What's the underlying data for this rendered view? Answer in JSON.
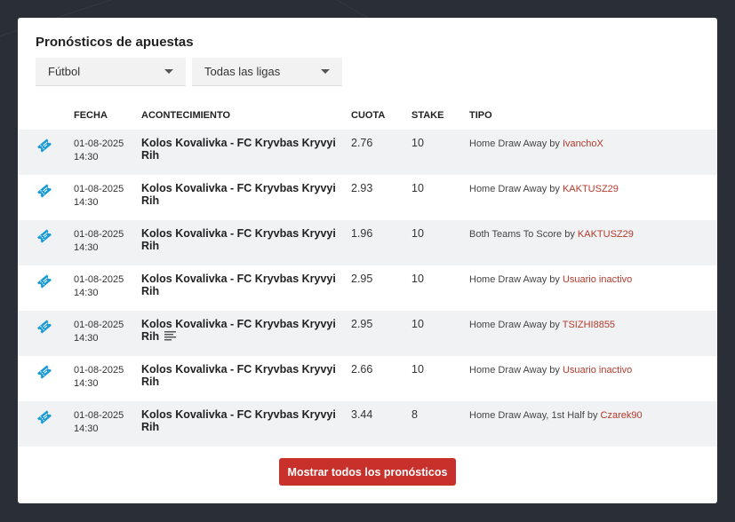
{
  "page": {
    "title": "Pronósticos de apuestas",
    "sport_filter": "Fútbol",
    "league_filter": "Todas las ligas",
    "show_all_label": "Mostrar todos los pronósticos"
  },
  "columns": {
    "fecha": "FECHA",
    "acontecimiento": "ACONTECIMIENTO",
    "cuota": "CUOTA",
    "stake": "STAKE",
    "tipo": "TIPO"
  },
  "rows": [
    {
      "date": "01-08-2025",
      "time": "14:30",
      "event": "Kolos Kovalivka - FC Kryvbas Kryvyi Rih",
      "odds": "2.76",
      "stake": "10",
      "tip": "Home Draw Away by",
      "user": "IvanchoX",
      "has_notes": false
    },
    {
      "date": "01-08-2025",
      "time": "14:30",
      "event": "Kolos Kovalivka - FC Kryvbas Kryvyi Rih",
      "odds": "2.93",
      "stake": "10",
      "tip": "Home Draw Away by",
      "user": "KAKTUSZ29",
      "has_notes": false
    },
    {
      "date": "01-08-2025",
      "time": "14:30",
      "event": "Kolos Kovalivka - FC Kryvbas Kryvyi Rih",
      "odds": "1.96",
      "stake": "10",
      "tip": "Both Teams To Score by",
      "user": "KAKTUSZ29",
      "has_notes": false
    },
    {
      "date": "01-08-2025",
      "time": "14:30",
      "event": "Kolos Kovalivka - FC Kryvbas Kryvyi Rih",
      "odds": "2.95",
      "stake": "10",
      "tip": "Home Draw Away by",
      "user": "Usuario inactivo",
      "has_notes": false
    },
    {
      "date": "01-08-2025",
      "time": "14:30",
      "event": "Kolos Kovalivka - FC Kryvbas Kryvyi Rih",
      "odds": "2.95",
      "stake": "10",
      "tip": "Home Draw Away by",
      "user": "TSIZHI8855",
      "has_notes": true
    },
    {
      "date": "01-08-2025",
      "time": "14:30",
      "event": "Kolos Kovalivka - FC Kryvbas Kryvyi Rih",
      "odds": "2.66",
      "stake": "10",
      "tip": "Home Draw Away by",
      "user": "Usuario inactivo",
      "has_notes": false
    },
    {
      "date": "01-08-2025",
      "time": "14:30",
      "event": "Kolos Kovalivka - FC Kryvbas Kryvyi Rih",
      "odds": "3.44",
      "stake": "8",
      "tip": "Home Draw Away, 1st Half by",
      "user": "Czarek90",
      "has_notes": false
    }
  ],
  "colors": {
    "accent": "#c8312b",
    "ticket_icon": "#1a9ad6",
    "user_link": "#b53a2c"
  }
}
